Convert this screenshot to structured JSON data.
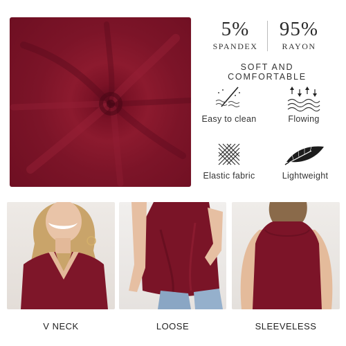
{
  "stats": [
    {
      "value": "5%",
      "label": "SPANDEX"
    },
    {
      "value": "95%",
      "label": "RAYON"
    }
  ],
  "headline": "SOFT AND COMFORTABLE",
  "features": [
    {
      "label": "Easy to clean",
      "icon": "easy-clean-icon"
    },
    {
      "label": "Flowing",
      "icon": "flowing-icon"
    },
    {
      "label": "Elastic fabric",
      "icon": "elastic-fabric-icon"
    },
    {
      "label": "Lightweight",
      "icon": "feather-icon"
    }
  ],
  "photos": [
    {
      "caption": "V NECK"
    },
    {
      "caption": "LOOSE"
    },
    {
      "caption": "SLEEVELESS"
    }
  ],
  "colors": {
    "fabric": "#7c1428",
    "text": "#2a2a2a"
  }
}
